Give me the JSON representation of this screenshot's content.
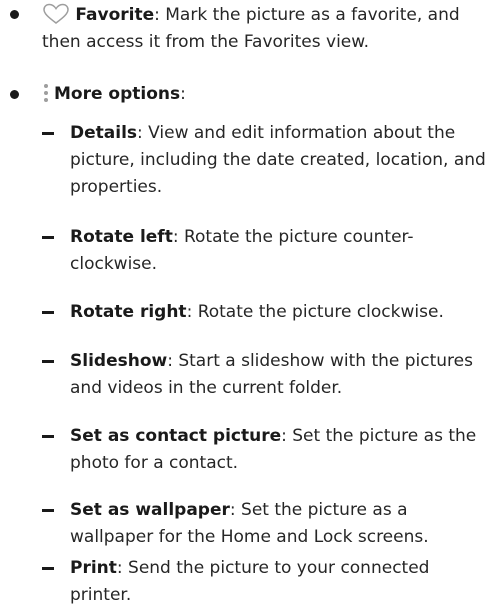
{
  "favorite": {
    "icon": "heart-outline-icon",
    "title": "Favorite",
    "description": ": Mark the picture as a favorite, and then access it from the Favorites view."
  },
  "more_options": {
    "icon": "more-options-vertical-dots-icon",
    "title": "More options",
    "suffix": ":",
    "items": [
      {
        "title": "Details",
        "description": ": View and edit information about the picture, including the date created, location, and properties."
      },
      {
        "title": "Rotate left",
        "description": ": Rotate the picture counter-clockwise."
      },
      {
        "title": "Rotate right",
        "description": ": Rotate the picture clockwise."
      },
      {
        "title": "Slideshow",
        "description": ": Start a slideshow with the pictures and videos in the current folder."
      },
      {
        "title": "Set as contact picture",
        "description": ": Set the picture as the photo for a contact."
      },
      {
        "title": "Set as wallpaper",
        "description": ": Set the picture as a wallpaper for the Home and Lock screens."
      },
      {
        "title": "Print",
        "description": ": Send the picture to your connected printer."
      }
    ]
  },
  "colors": {
    "text": "#262626",
    "icon_outline": "#9e9e9e"
  }
}
